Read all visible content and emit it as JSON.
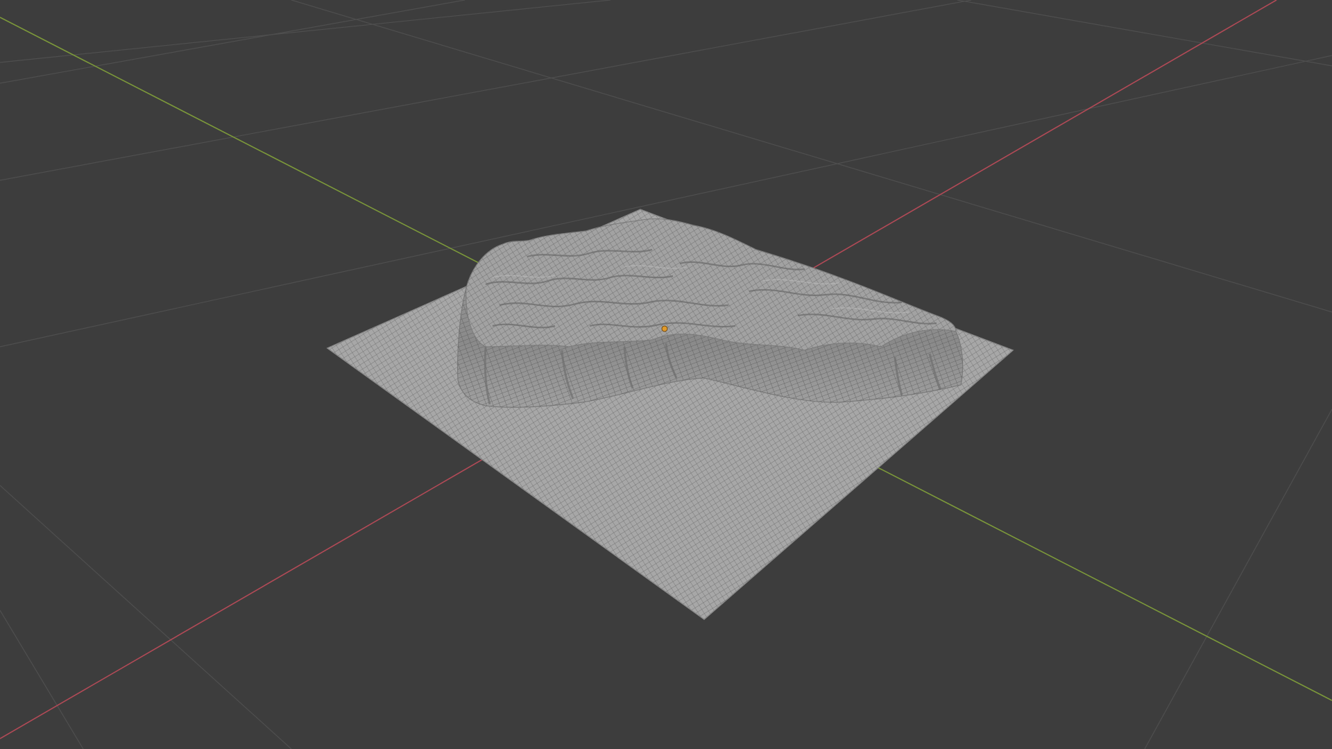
{
  "app": {
    "kind": "3d-viewport",
    "view": "perspective"
  },
  "viewport": {
    "background_color": "#3d3d3d",
    "grid_color": "#555555",
    "x_axis_color": "#b34a57",
    "y_axis_color": "#7d9a3a"
  },
  "scene": {
    "objects": [
      {
        "name_icon": "terrain-mesh",
        "shading": "solid-wireframe",
        "mesh_color": "#a8a8a8",
        "wire_color": "#4a4a4a",
        "has_origin_marker": true,
        "origin_color": "#e09a2a"
      }
    ]
  }
}
